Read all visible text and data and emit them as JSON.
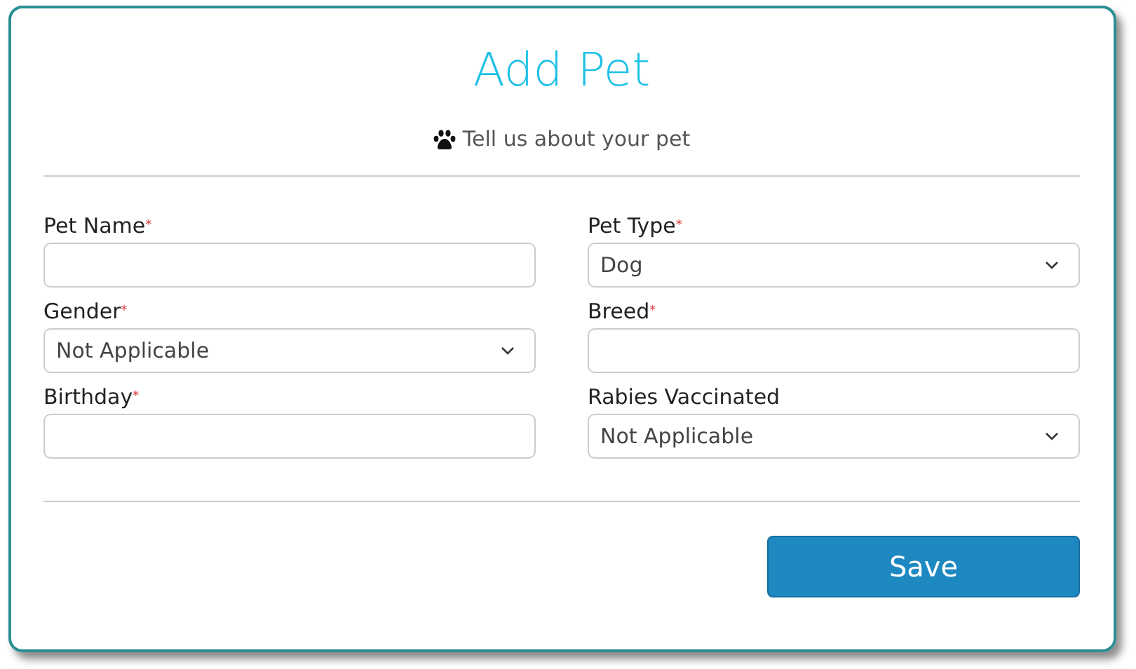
{
  "title": "Add Pet",
  "subtitle": "Tell us about your pet",
  "fields": [
    {
      "label": "Pet Name",
      "required_mark": "*",
      "kind": "text"
    },
    {
      "label": "Pet Type",
      "required_mark": "*",
      "kind": "select",
      "value": "Dog"
    },
    {
      "label": "Gender",
      "required_mark": "*",
      "kind": "select",
      "value": "Not Applicable"
    },
    {
      "label": "Breed",
      "required_mark": "*",
      "kind": "text"
    },
    {
      "label": "Birthday",
      "required_mark": "*",
      "kind": "text"
    },
    {
      "label": "Rabies Vaccinated",
      "kind": "select",
      "value": "Not Applicable"
    }
  ],
  "buttons": [
    "Save"
  ]
}
